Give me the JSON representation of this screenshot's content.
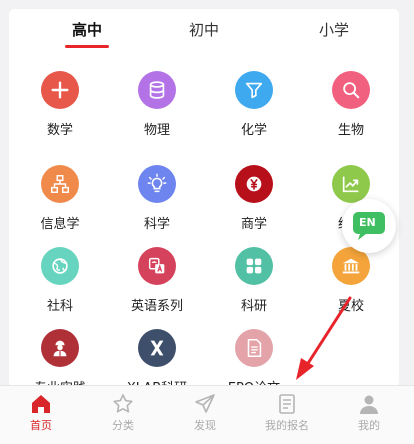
{
  "tabs": [
    {
      "label": "高中",
      "active": true
    },
    {
      "label": "初中",
      "active": false
    },
    {
      "label": "小学",
      "active": false
    }
  ],
  "subjects": [
    {
      "label": "数学",
      "icon": "plus-icon",
      "color": "#e8584a"
    },
    {
      "label": "物理",
      "icon": "database-icon",
      "color": "#b373e6"
    },
    {
      "label": "化学",
      "icon": "funnel-icon",
      "color": "#3fa9ef"
    },
    {
      "label": "生物",
      "icon": "search-icon",
      "color": "#f2607f"
    },
    {
      "label": "信息学",
      "icon": "sitemap-icon",
      "color": "#f08a4b"
    },
    {
      "label": "科学",
      "icon": "lightbulb-icon",
      "color": "#6e85ef"
    },
    {
      "label": "商学",
      "icon": "yen-coin-icon",
      "color": "#b8101a"
    },
    {
      "label": "经济",
      "icon": "trend-chart-icon",
      "color": "#8fc94c"
    },
    {
      "label": "社科",
      "icon": "globe-icon",
      "color": "#67d4bf"
    },
    {
      "label": "英语系列",
      "icon": "translate-icon",
      "color": "#d5425b"
    },
    {
      "label": "科研",
      "icon": "grid-icon",
      "color": "#52c0a4"
    },
    {
      "label": "夏校",
      "icon": "bank-icon",
      "color": "#f4a43a"
    },
    {
      "label": "专业实践",
      "icon": "worker-icon",
      "color": "#b03038"
    },
    {
      "label": "XLAB科研",
      "icon": "x-logo-icon",
      "color": "#3d4f6b"
    },
    {
      "label": "EPQ论文",
      "icon": "document-icon",
      "color": "#e3a3a9"
    }
  ],
  "floating_button": {
    "label": "EN",
    "color": "#3fbf62"
  },
  "nav": [
    {
      "label": "首页",
      "icon": "home-icon",
      "active": true
    },
    {
      "label": "分类",
      "icon": "star-icon",
      "active": false
    },
    {
      "label": "发现",
      "icon": "paper-plane-icon",
      "active": false
    },
    {
      "label": "我的报名",
      "icon": "list-icon",
      "active": false
    },
    {
      "label": "我的",
      "icon": "person-icon",
      "active": false
    }
  ],
  "colors": {
    "accent": "#e8242b",
    "nav_inactive": "#aaaaaa"
  }
}
